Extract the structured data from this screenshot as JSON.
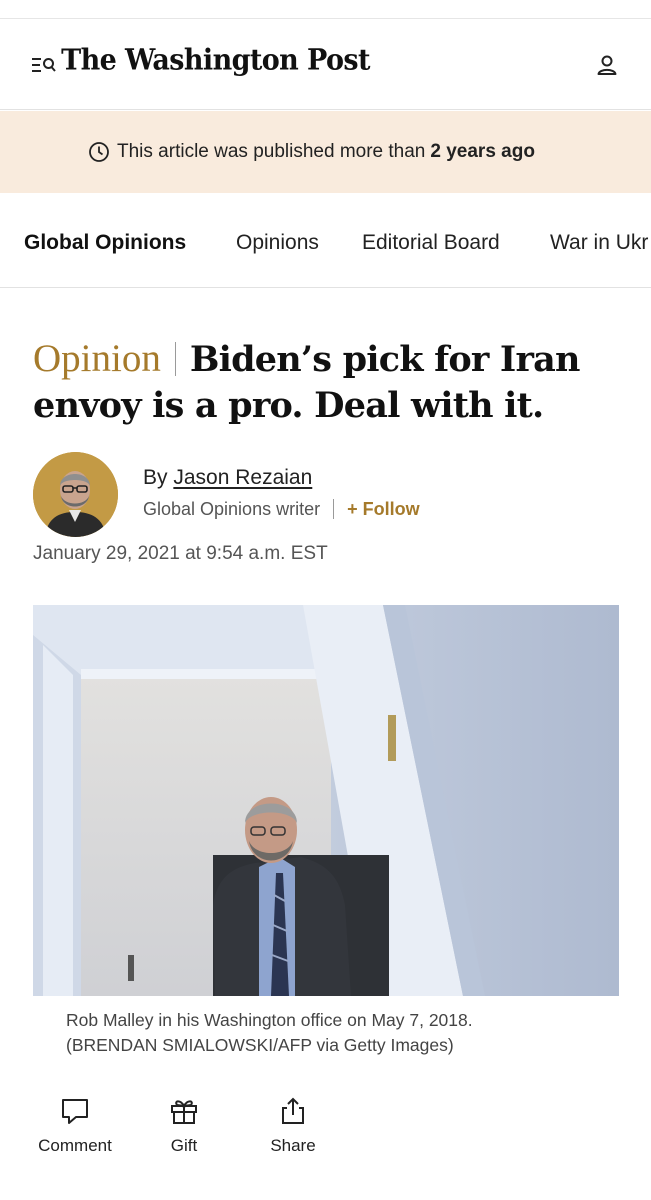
{
  "header": {
    "logo_text": "The Washington Post",
    "menu_icon": "menu-search-icon",
    "account_icon": "user-icon"
  },
  "banner": {
    "icon": "clock-icon",
    "text_prefix": "This article was published more than",
    "text_bold": "2 years ago"
  },
  "nav": {
    "items": [
      {
        "label": "Global Opinions"
      },
      {
        "label": "Opinions"
      },
      {
        "label": "Editorial Board"
      },
      {
        "label": "War in Ukr"
      }
    ]
  },
  "article": {
    "kicker": "Opinion",
    "title": "Biden’s pick for Iran envoy is a pro. Deal with it.",
    "byline_prefix": "By",
    "author": "Jason Rezaian",
    "author_role": "Global Opinions writer",
    "follow_label": "+ Follow",
    "date": "January 29, 2021 at 9:54 a.m. EST",
    "caption_line1": "Rob Malley in his Washington office on May 7, 2018.",
    "caption_line2": "(BRENDAN SMIALOWSKI/AFP via Getty Images)"
  },
  "actions": {
    "comment_label": "Comment",
    "gift_label": "Gift",
    "share_label": "Share"
  },
  "colors": {
    "banner_bg": "#f9ebdd",
    "kicker_gold": "#a57a2b",
    "avatar_bg": "#c39a45"
  }
}
